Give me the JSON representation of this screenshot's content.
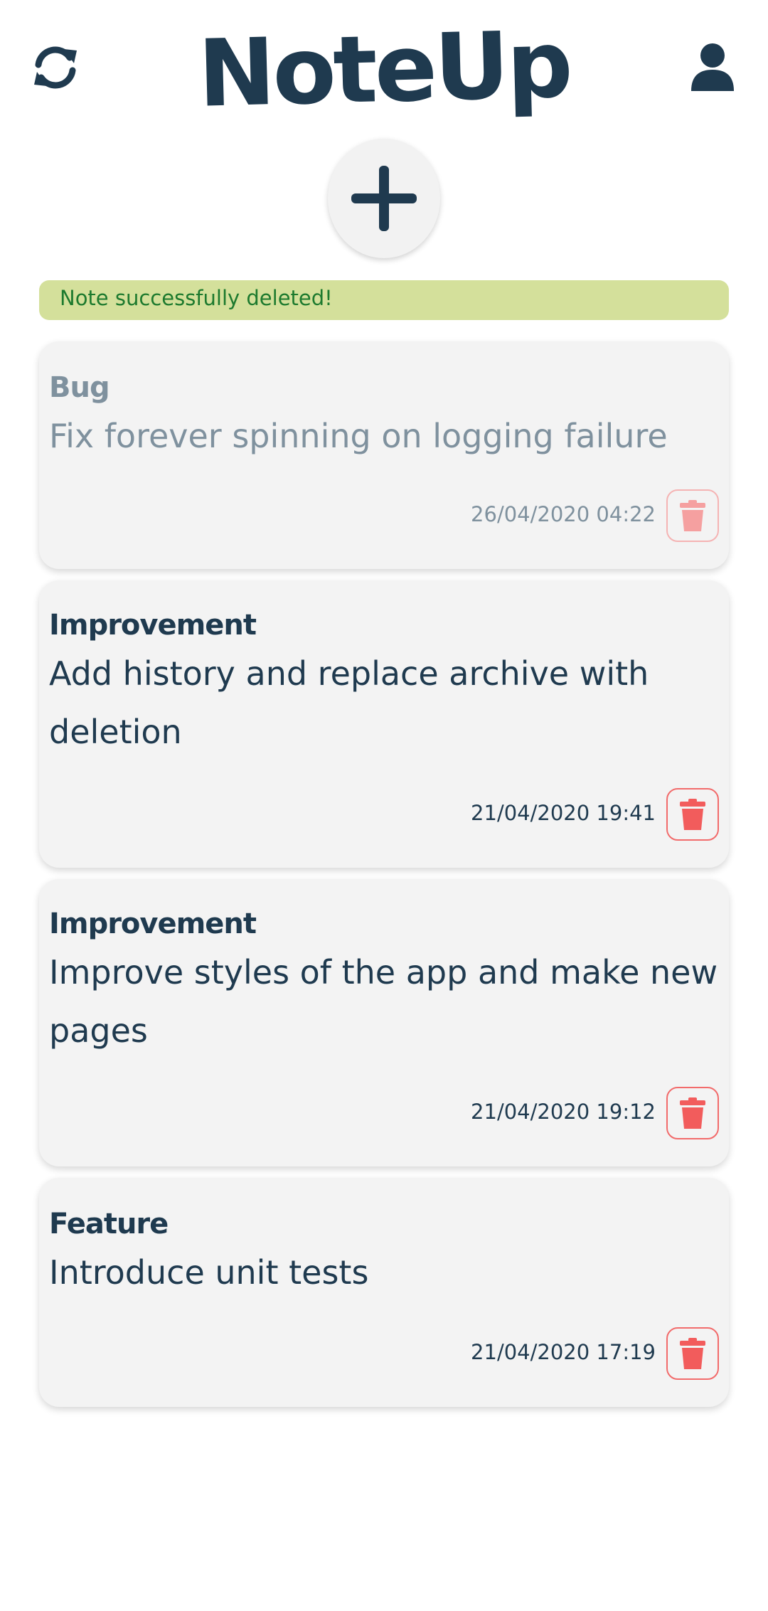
{
  "app": {
    "title": "NoteUp"
  },
  "header": {
    "refresh_icon": "refresh-icon",
    "profile_icon": "user-icon",
    "add_icon": "plus-icon"
  },
  "toast": {
    "message": "Note successfully deleted!"
  },
  "colors": {
    "primary": "#1f3a4f",
    "toast_bg": "#d4e09b",
    "toast_text": "#1d7a2e",
    "delete": "#f25c5c",
    "card_bg": "#f3f3f3",
    "faded_text": "#7f919e"
  },
  "notes": [
    {
      "category": "Bug",
      "title": "Fix forever spinning on logging failure",
      "date": "26/04/2020 04:22",
      "faded": true
    },
    {
      "category": "Improvement",
      "title": "Add history and replace archive with deletion",
      "date": "21/04/2020 19:41",
      "faded": false
    },
    {
      "category": "Improvement",
      "title": "Improve styles of the app and make new pages",
      "date": "21/04/2020 19:12",
      "faded": false
    },
    {
      "category": "Feature",
      "title": "Introduce unit tests",
      "date": "21/04/2020 17:19",
      "faded": false
    }
  ]
}
